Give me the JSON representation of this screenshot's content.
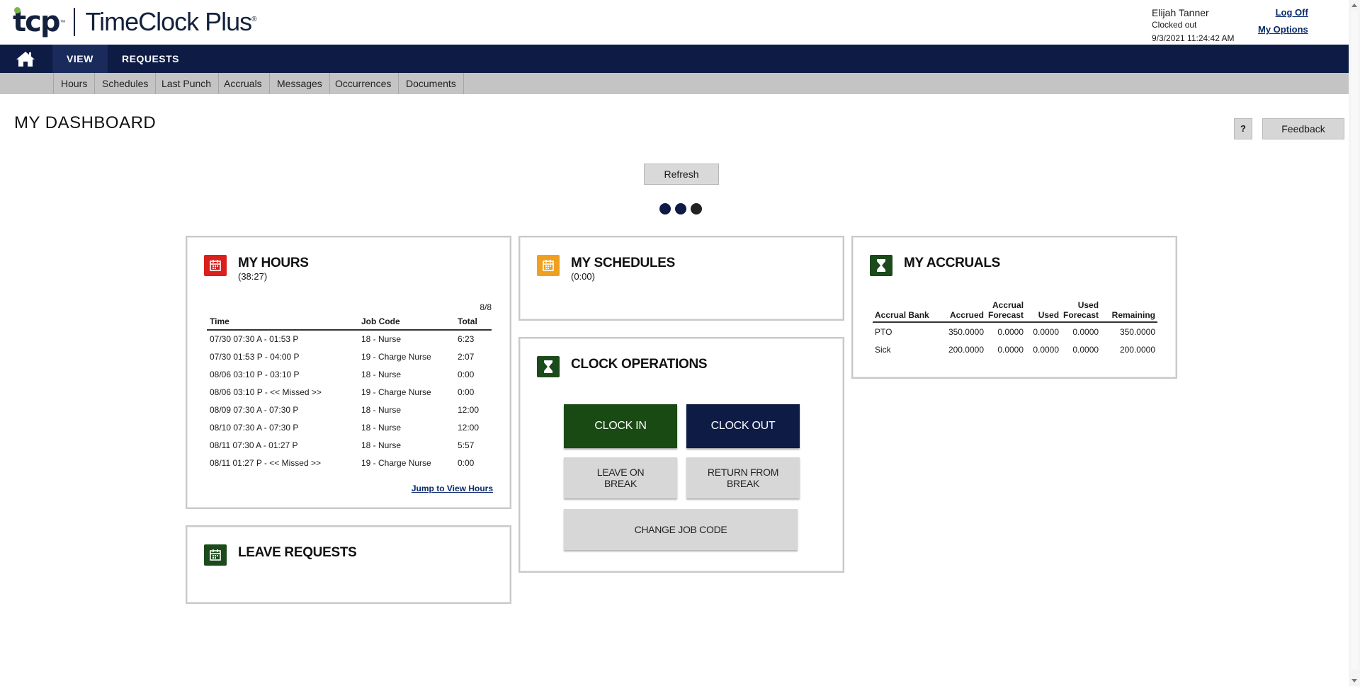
{
  "header": {
    "logo_abbr": "tcp",
    "logo_tm": "™",
    "logo_name": "TimeClock Plus",
    "logo_reg": "®",
    "user_name": "Elijah Tanner",
    "user_status": "Clocked out",
    "datetime": "9/3/2021  11:24:42 AM",
    "log_off": "Log Off",
    "my_options": "My Options"
  },
  "nav": {
    "items": [
      {
        "label": "VIEW"
      },
      {
        "label": "REQUESTS"
      }
    ]
  },
  "subnav": {
    "items": [
      {
        "label": "Hours"
      },
      {
        "label": "Schedules"
      },
      {
        "label": "Last Punch"
      },
      {
        "label": "Accruals"
      },
      {
        "label": "Messages"
      },
      {
        "label": "Occurrences"
      },
      {
        "label": "Documents"
      }
    ]
  },
  "page": {
    "title": "MY DASHBOARD",
    "help_label": "?",
    "feedback_label": "Feedback",
    "refresh_label": "Refresh"
  },
  "my_hours": {
    "title": "MY HOURS",
    "subtitle": "(38:27)",
    "count": "8/8",
    "columns": [
      "Time",
      "Job Code",
      "Total"
    ],
    "rows": [
      {
        "time": "07/30 07:30 A - 01:53 P",
        "job": "18 - Nurse",
        "total": "6:23"
      },
      {
        "time": "07/30 01:53 P - 04:00 P",
        "job": "19 - Charge Nurse",
        "total": "2:07"
      },
      {
        "time": "08/06 03:10 P - 03:10 P",
        "job": "18 - Nurse",
        "total": "0:00"
      },
      {
        "time": "08/06 03:10 P - << Missed >>",
        "job": "19 - Charge Nurse",
        "total": "0:00"
      },
      {
        "time": "08/09 07:30 A - 07:30 P",
        "job": "18 - Nurse",
        "total": "12:00"
      },
      {
        "time": "08/10 07:30 A - 07:30 P",
        "job": "18 - Nurse",
        "total": "12:00"
      },
      {
        "time": "08/11 07:30 A - 01:27 P",
        "job": "18 - Nurse",
        "total": "5:57"
      },
      {
        "time": "08/11 01:27 P - << Missed >>",
        "job": "19 - Charge Nurse",
        "total": "0:00"
      }
    ],
    "jump_link": "Jump to View Hours"
  },
  "my_schedules": {
    "title": "MY SCHEDULES",
    "subtitle": "(0:00)"
  },
  "my_accruals": {
    "title": "MY ACCRUALS",
    "columns": [
      "Accrual Bank",
      "Accrued",
      "Accrual Forecast",
      "Used",
      "Used Forecast",
      "Remaining"
    ],
    "rows": [
      {
        "bank": "PTO",
        "accrued": "350.0000",
        "accrual_forecast": "0.0000",
        "used": "0.0000",
        "used_forecast": "0.0000",
        "remaining": "350.0000"
      },
      {
        "bank": "Sick",
        "accrued": "200.0000",
        "accrual_forecast": "0.0000",
        "used": "0.0000",
        "used_forecast": "0.0000",
        "remaining": "200.0000"
      }
    ]
  },
  "clock_ops": {
    "title": "CLOCK OPERATIONS",
    "clock_in": "CLOCK IN",
    "clock_out": "CLOCK OUT",
    "leave_break_1": "LEAVE ON",
    "leave_break_2": "BREAK",
    "return_break_1": "RETURN FROM",
    "return_break_2": "BREAK",
    "change_job": "CHANGE JOB CODE"
  },
  "leave_requests": {
    "title": "LEAVE REQUESTS"
  },
  "colors": {
    "navy": "#0d1b45",
    "green": "#1a4a14",
    "red_icon": "#d9201c",
    "orange_icon": "#f0a020",
    "accent_green": "#7ab648"
  },
  "icons": [
    "home-icon",
    "calendar-icon",
    "hourglass-icon"
  ]
}
